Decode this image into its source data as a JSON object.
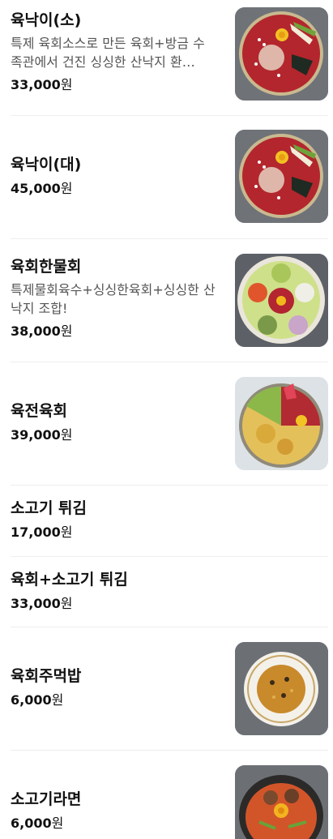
{
  "currency": "원",
  "items": [
    {
      "name": "육낙이(소)",
      "description": "특제 육회소스로 만든 육회+방금 수족관에서 건진 싱싱한 산낙지 환…",
      "price": "33,000",
      "image_icon": "yuknaki-plate-image"
    },
    {
      "name": "육낙이(대)",
      "description": "",
      "price": "45,000",
      "image_icon": "yuknaki-plate-image"
    },
    {
      "name": "육회한물회",
      "description": "특제물회육수+싱싱한육회+싱싱한 산낙지 조합!",
      "price": "38,000",
      "image_icon": "mulhoe-plate-image"
    },
    {
      "name": "육전육회",
      "description": "",
      "price": "39,000",
      "image_icon": "yukjeon-plate-image"
    },
    {
      "name": "소고기 튀김",
      "description": "",
      "price": "17,000"
    },
    {
      "name": "육회+소고기 튀김",
      "description": "",
      "price": "33,000"
    },
    {
      "name": "육회주먹밥",
      "description": "",
      "price": "6,000",
      "image_icon": "rice-ball-image"
    },
    {
      "name": "소고기라면",
      "description": "",
      "price": "6,000",
      "image_icon": "ramen-pot-image"
    }
  ]
}
